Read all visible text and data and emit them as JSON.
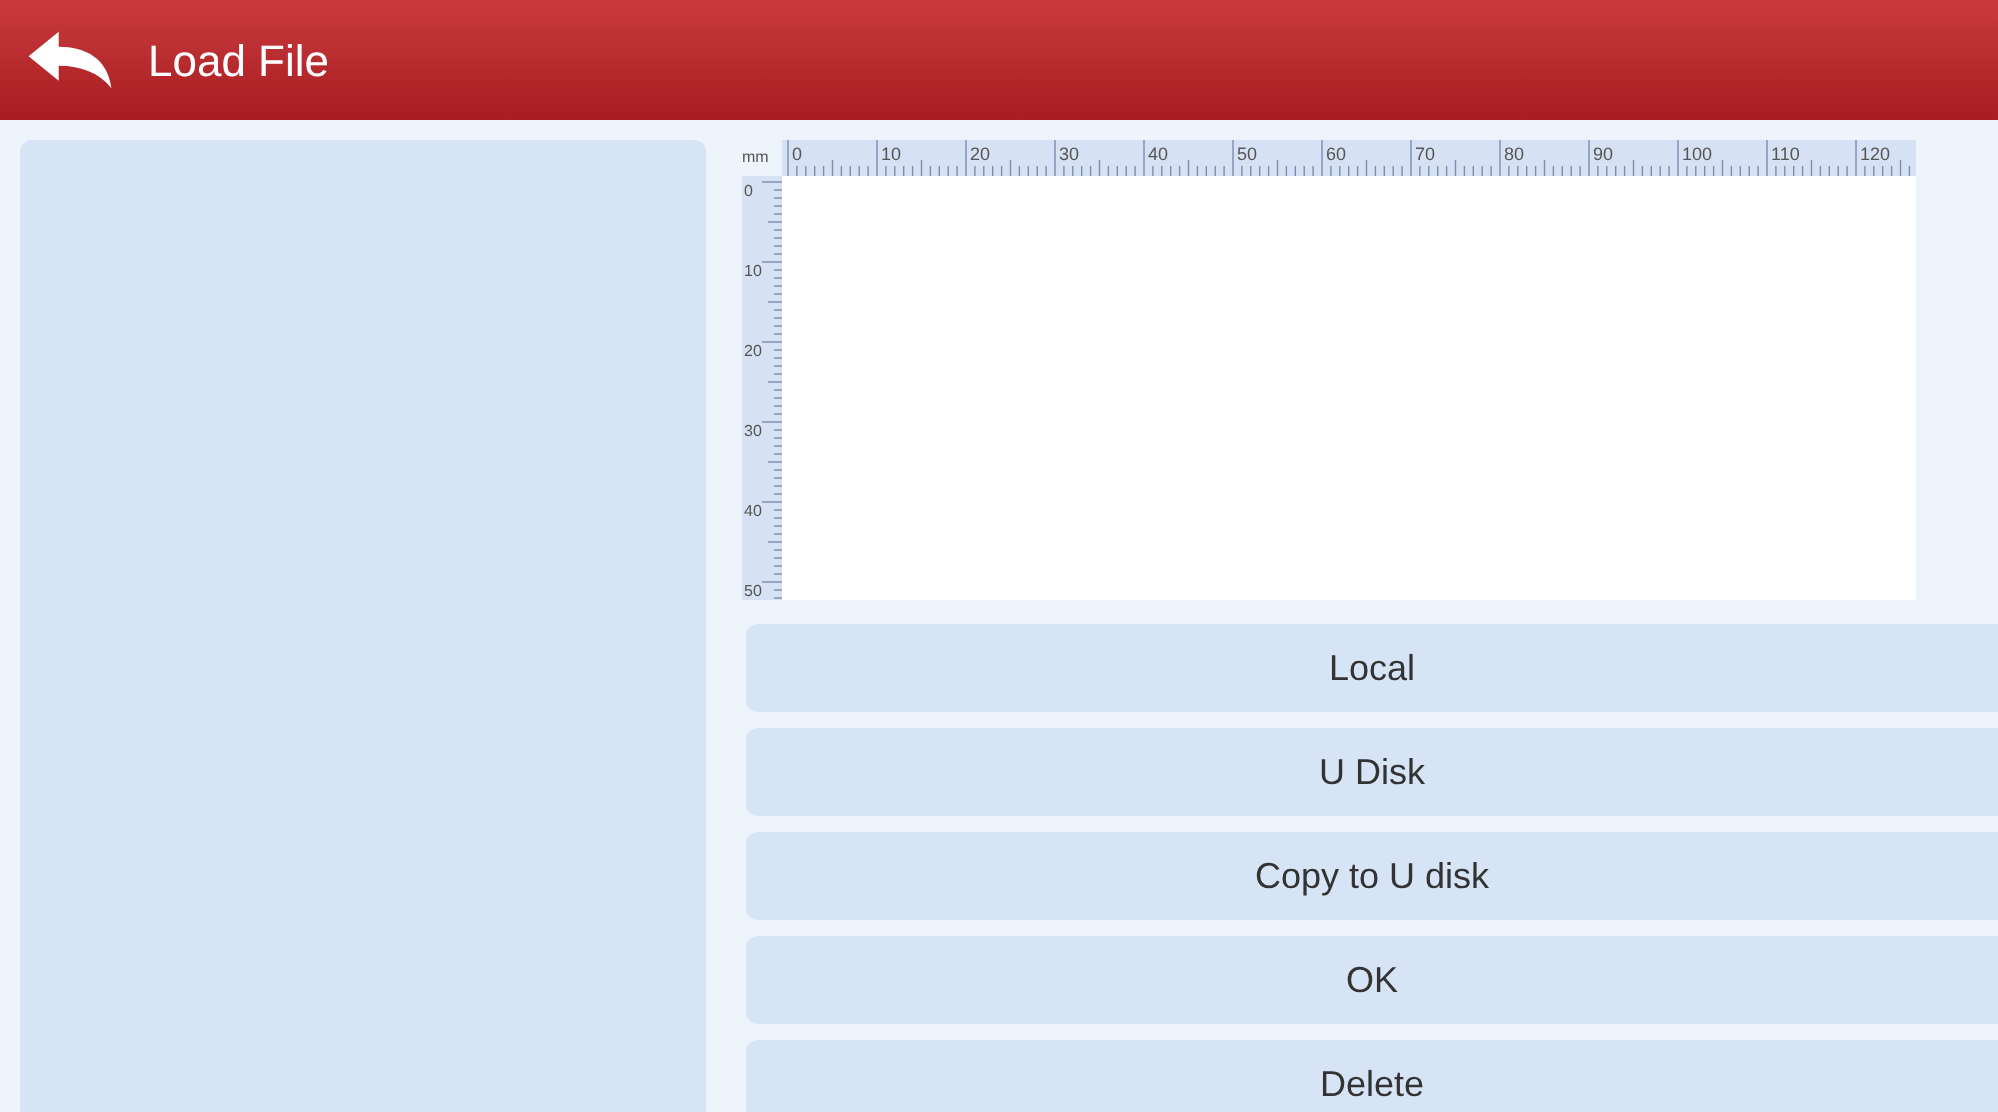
{
  "header": {
    "title": "Load File"
  },
  "ruler": {
    "unit": "mm",
    "x_labels": [
      "0",
      "10",
      "20",
      "30",
      "40",
      "50",
      "60",
      "70",
      "80",
      "90",
      "100",
      "110",
      "120"
    ],
    "y_labels": [
      "0",
      "10",
      "20",
      "30",
      "40",
      "50"
    ]
  },
  "buttons": [
    "Local",
    "U Disk",
    "Copy to U disk",
    "OK",
    "Delete"
  ]
}
